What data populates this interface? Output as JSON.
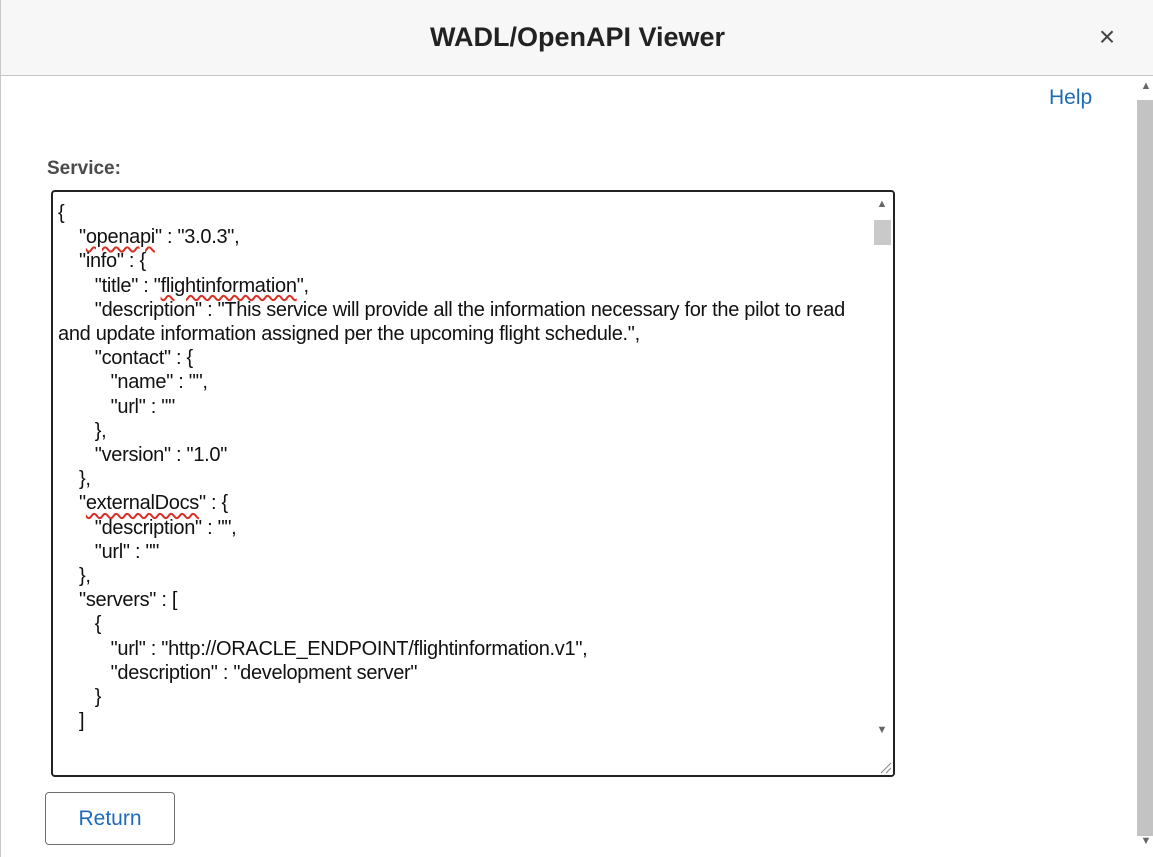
{
  "dialog": {
    "title": "WADL/OpenAPI Viewer",
    "close_symbol": "×",
    "help_label": "Help"
  },
  "service": {
    "label": "Service:",
    "code_lines": [
      {
        "pre": "{",
        "mark": "",
        "post": ""
      },
      {
        "pre": "    \"",
        "mark": "openapi",
        "post": "\" : \"3.0.3\","
      },
      {
        "pre": "    \"info\" : {",
        "mark": "",
        "post": ""
      },
      {
        "pre": "       \"title\" : \"",
        "mark": "flightinformation",
        "post": "\","
      },
      {
        "pre": "       \"description\" : \"This service will provide all the information necessary for the pilot to read and update information assigned per the upcoming flight schedule.\",",
        "mark": "",
        "post": ""
      },
      {
        "pre": "       \"contact\" : {",
        "mark": "",
        "post": ""
      },
      {
        "pre": "          \"name\" : \"\",",
        "mark": "",
        "post": ""
      },
      {
        "pre": "          \"url\" : \"\"",
        "mark": "",
        "post": ""
      },
      {
        "pre": "       },",
        "mark": "",
        "post": ""
      },
      {
        "pre": "       \"version\" : \"1.0\"",
        "mark": "",
        "post": ""
      },
      {
        "pre": "    },",
        "mark": "",
        "post": ""
      },
      {
        "pre": "    \"",
        "mark": "externalDocs",
        "post": "\" : {"
      },
      {
        "pre": "       \"description\" : \"\",",
        "mark": "",
        "post": ""
      },
      {
        "pre": "       \"url\" : \"\"",
        "mark": "",
        "post": ""
      },
      {
        "pre": "    },",
        "mark": "",
        "post": ""
      },
      {
        "pre": "    \"servers\" : [",
        "mark": "",
        "post": ""
      },
      {
        "pre": "       {",
        "mark": "",
        "post": ""
      },
      {
        "pre": "          \"url\" : \"http://ORACLE_ENDPOINT/flightinformation.v1\",",
        "mark": "",
        "post": ""
      },
      {
        "pre": "          \"description\" : \"development server\"",
        "mark": "",
        "post": ""
      },
      {
        "pre": "       }",
        "mark": "",
        "post": ""
      },
      {
        "pre": "    ]",
        "mark": "",
        "post": ""
      }
    ]
  },
  "buttons": {
    "return_label": "Return"
  },
  "scrollbar": {
    "up_arrow": "▲",
    "down_arrow": "▼"
  },
  "colors": {
    "link": "#1e6bb8",
    "spellcheck": "#d93025"
  }
}
